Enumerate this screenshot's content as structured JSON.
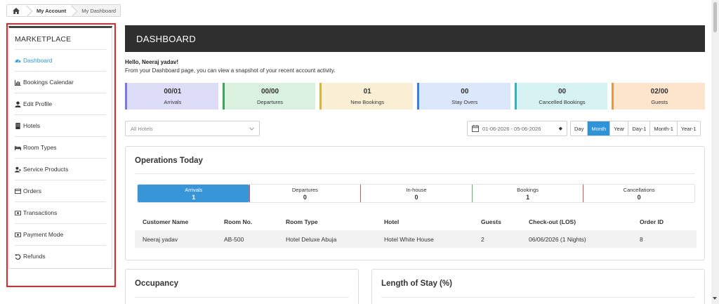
{
  "breadcrumb": {
    "home_icon": "home-icon",
    "items": [
      "My Account",
      "My Dashboard"
    ]
  },
  "sidebar": {
    "title": "MARKETPLACE",
    "items": [
      {
        "label": "Dashboard",
        "icon": "dashboard-icon",
        "active": true
      },
      {
        "label": "Bookings Calendar",
        "icon": "bar-chart-icon"
      },
      {
        "label": "Edit Profile",
        "icon": "user-icon"
      },
      {
        "label": "Hotels",
        "icon": "building-icon"
      },
      {
        "label": "Room Types",
        "icon": "bed-icon"
      },
      {
        "label": "Service Products",
        "icon": "user-plus-icon"
      },
      {
        "label": "Orders",
        "icon": "list-icon"
      },
      {
        "label": "Transactions",
        "icon": "money-icon"
      },
      {
        "label": "Payment Mode",
        "icon": "money-icon"
      },
      {
        "label": "Refunds",
        "icon": "undo-icon"
      }
    ]
  },
  "header": {
    "title": "DASHBOARD"
  },
  "greeting": "Hello, Neeraj yadav!",
  "intro": "From your Dashboard page, you can view a snapshot of your recent account activity.",
  "stats": [
    {
      "value": "00/01",
      "label": "Arrivals",
      "bg": "#ddddf8",
      "border": "#7a7ad8"
    },
    {
      "value": "00/00",
      "label": "Departures",
      "bg": "#dbf1e0",
      "border": "#3aa65a"
    },
    {
      "value": "01",
      "label": "New Bookings",
      "bg": "#fbf0d6",
      "border": "#e2b235"
    },
    {
      "value": "00",
      "label": "Stay Overs",
      "bg": "#dbe7fb",
      "border": "#3c7edc"
    },
    {
      "value": "00",
      "label": "Cancelled Bookings",
      "bg": "#d6f2f3",
      "border": "#30b4bd"
    },
    {
      "value": "02/00",
      "label": "Guests",
      "bg": "#fde4cd",
      "border": "#ec9542"
    }
  ],
  "filters": {
    "hotel_select": "All Hotels",
    "date_range": "01-06-2026 - 05-06-2026",
    "periods": [
      "Day",
      "Month",
      "Year",
      "Day-1",
      "Month-1",
      "Year-1"
    ],
    "active_period": "Month"
  },
  "operations": {
    "title": "Operations Today",
    "tabs": [
      {
        "label": "Arrivals",
        "count": "1",
        "active": true,
        "color": "#3896d8"
      },
      {
        "label": "Departures",
        "count": "0",
        "color": "#d9534f"
      },
      {
        "label": "In-house",
        "count": "0",
        "color": "#d9534f"
      },
      {
        "label": "Bookings",
        "count": "1",
        "color": "#5cb85c"
      },
      {
        "label": "Cancellations",
        "count": "0",
        "color": "#d9534f"
      }
    ],
    "columns": [
      "Customer Name",
      "Room No.",
      "Room Type",
      "Hotel",
      "Guests",
      "Check-out (LOS)",
      "Order ID"
    ],
    "rows": [
      [
        "Neeraj yadav",
        "AB-500",
        "Hotel Deluxe Abuja",
        "Hotel White House",
        "2",
        "06/06/2026 (1 Nights)",
        "8"
      ]
    ]
  },
  "panels": {
    "occupancy": "Occupancy",
    "length_of_stay": "Length of Stay (%)"
  }
}
